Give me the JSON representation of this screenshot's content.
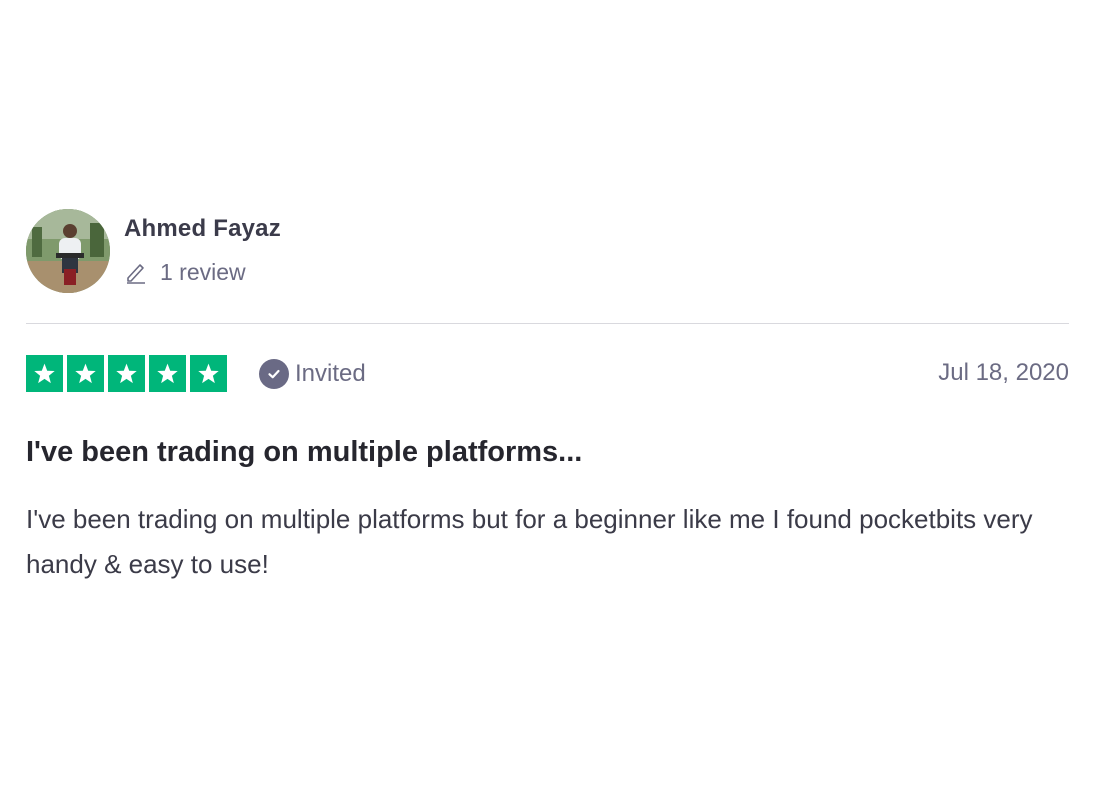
{
  "reviewer": {
    "name": "Ahmed Fayaz",
    "review_count": "1 review",
    "avatar_icon": "user-photo-avatar"
  },
  "rating": {
    "stars": 5,
    "max_stars": 5,
    "star_color": "#00b67a",
    "verification_label": "Invited",
    "date": "Jul 18, 2020"
  },
  "review": {
    "title": "I've been trading on multiple platforms...",
    "body": "I've been trading on multiple platforms but for a beginner like me I found pocketbits very handy & easy to use!"
  },
  "icons": {
    "pencil": "pencil-icon",
    "verified": "check-circle-icon",
    "star": "star-icon"
  }
}
